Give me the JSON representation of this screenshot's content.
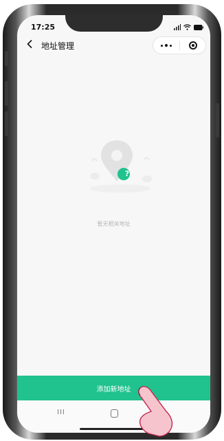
{
  "status_bar": {
    "time": "17:25"
  },
  "nav": {
    "title": "地址管理",
    "more_icon": "more-dots-icon",
    "close_icon": "target-circle-icon"
  },
  "empty_state": {
    "message": "暂无相关地址",
    "icon": "location-pin-question-icon",
    "badge_symbol": "?"
  },
  "actions": {
    "add_address": "添加新地址"
  },
  "system_nav": {
    "recent_symbol": "III"
  },
  "colors": {
    "accent": "#20c28d",
    "background": "#f7f7f7",
    "text": "#111111",
    "muted_text": "#b4b4b4",
    "hand_fill": "#f6c4cd",
    "hand_stroke": "#c2264f"
  }
}
